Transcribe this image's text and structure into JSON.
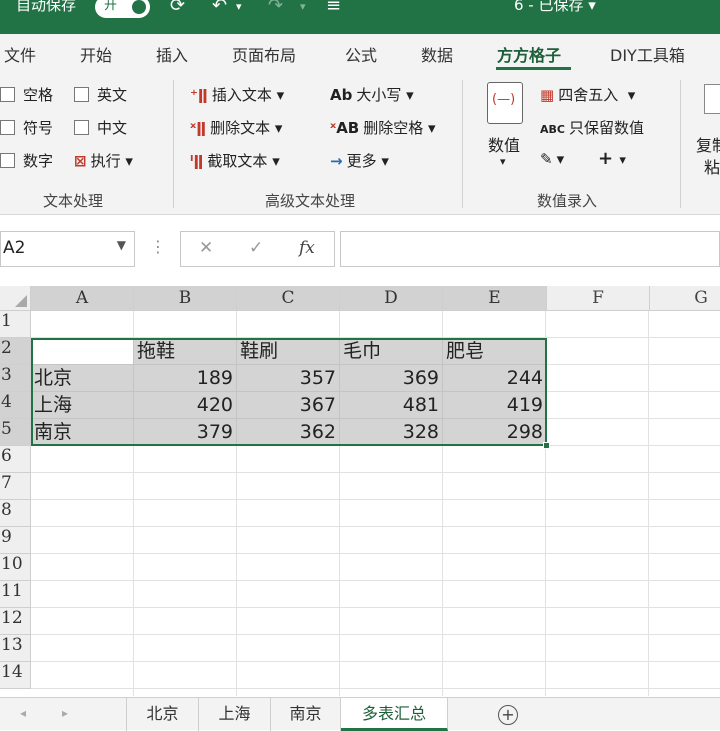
{
  "titlebar": {
    "autosave_label": "自动保存",
    "toggle_label": "开",
    "doc_title": "6 - 已保存 ▾"
  },
  "menu": {
    "tabs": [
      "文件",
      "开始",
      "插入",
      "页面布局",
      "公式",
      "数据",
      "方方格子",
      "DIY工具箱"
    ],
    "active_tab": "方方格子"
  },
  "ribbon": {
    "text_group": {
      "label": "文本处理",
      "items": [
        "空格",
        "英文",
        "符号",
        "中文",
        "数字",
        "执行"
      ]
    },
    "adv_group": {
      "label": "高级文本处理",
      "insert": "插入文本",
      "delete": "删除文本",
      "extract": "截取文本",
      "case": "大小写",
      "del_space": "删除空格",
      "more": "更多"
    },
    "num_group": {
      "label": "数值录入",
      "value_btn": "数值",
      "round": "四舍五入",
      "keep_value": "只保留数值"
    },
    "clip_group": {
      "label_top": "复制",
      "label_bottom": "粘"
    }
  },
  "formula_bar": {
    "name_box": "A2",
    "fx": "fx",
    "value": ""
  },
  "columns": [
    "A",
    "B",
    "C",
    "D",
    "E",
    "F",
    "G"
  ],
  "rows": [
    "1",
    "2",
    "3",
    "4",
    "5",
    "6",
    "7",
    "8",
    "9",
    "10",
    "11",
    "12",
    "13",
    "14"
  ],
  "sheet": {
    "header_row": [
      "",
      "拖鞋",
      "鞋刷",
      "毛巾",
      "肥皂"
    ],
    "data_rows": [
      {
        "city": "北京",
        "values": [
          189,
          357,
          369,
          244
        ]
      },
      {
        "city": "上海",
        "values": [
          420,
          367,
          481,
          419
        ]
      },
      {
        "city": "南京",
        "values": [
          379,
          362,
          328,
          298
        ]
      }
    ]
  },
  "sheet_tabs": {
    "tabs": [
      "北京",
      "上海",
      "南京",
      "多表汇总"
    ],
    "active": "多表汇总"
  },
  "colors": {
    "accent": "#217346",
    "selection_fill": "#d4d4d4"
  }
}
